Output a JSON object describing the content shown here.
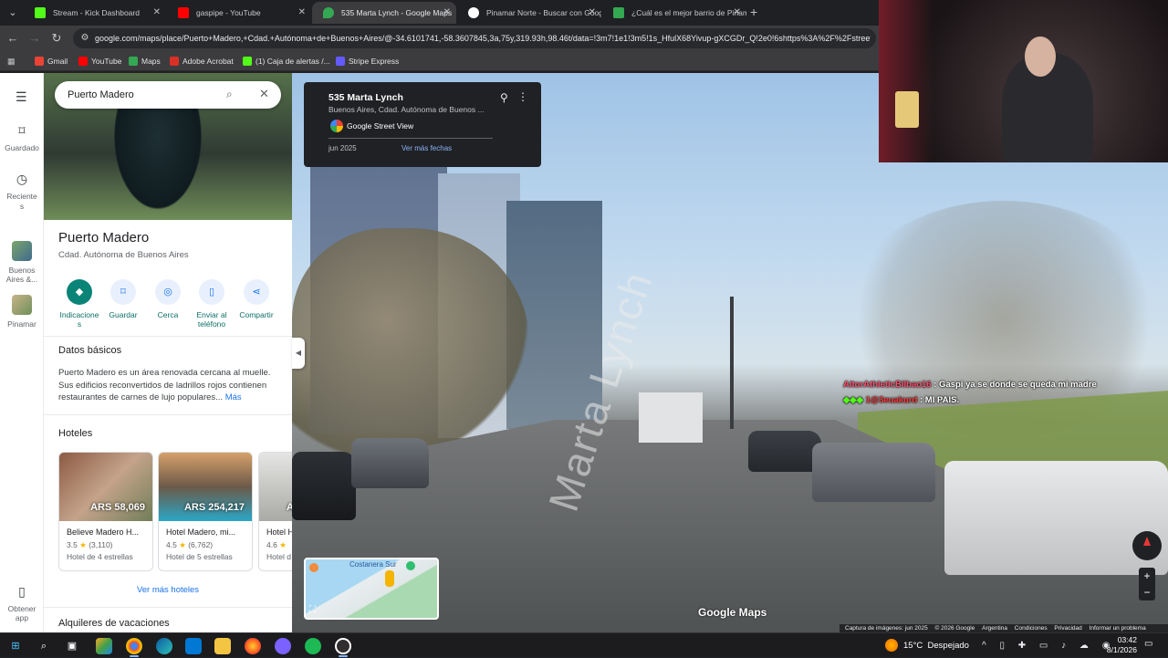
{
  "browser": {
    "tabs": [
      {
        "title": "Stream - Kick Dashboard",
        "favicon_color": "#53fc18",
        "active": false
      },
      {
        "title": "gaspipe - YouTube",
        "favicon_color": "#ff0000",
        "active": false
      },
      {
        "title": "535 Marta Lynch - Google Maps",
        "favicon_color": "#34a853",
        "active": true
      },
      {
        "title": "Pinamar Norte - Buscar con Google",
        "favicon_color": "#4285f4",
        "active": false
      },
      {
        "title": "¿Cuál es el mejor barrio de Pinamar?",
        "favicon_color": "#34a853",
        "active": false
      }
    ],
    "new_tab": "+",
    "url": "google.com/maps/place/Puerto+Madero,+Cdad.+Autónoma+de+Buenos+Aires/@-34.6101741,-58.3607845,3a,75y,319.93h,98.46t/data=!3m7!1e1!3m5!1s_HfulX68Yivup-gXCGDr_Q!2e0!6shttps%3A%2F%2Fstreetv",
    "bookmarks": [
      {
        "label": "Gmail",
        "color": "#ea4335"
      },
      {
        "label": "YouTube",
        "color": "#ff0000"
      },
      {
        "label": "Maps",
        "color": "#34a853"
      },
      {
        "label": "Adobe Acrobat",
        "color": "#d93025"
      },
      {
        "label": "(1) Caja de alertas /...",
        "color": "#53fc18"
      },
      {
        "label": "Stripe Express",
        "color": "#635bff"
      }
    ]
  },
  "maps": {
    "search_value": "Puerto Madero",
    "rail": [
      {
        "label": "Guardado",
        "icon": "bookmark-icon"
      },
      {
        "label": "Reciente s",
        "icon": "history-icon"
      },
      {
        "label": "Buenos Aires &...",
        "icon": "thumbnail"
      },
      {
        "label": "Pinamar",
        "icon": "thumbnail"
      },
      {
        "label": "Obtener app",
        "icon": "phone-icon"
      }
    ],
    "place": {
      "title": "Puerto Madero",
      "subtitle": "Cdad. Autónoma de Buenos Aires"
    },
    "actions": [
      {
        "label": "Indicaciones",
        "icon": "directions-icon"
      },
      {
        "label": "Guardar",
        "icon": "bookmark-icon"
      },
      {
        "label": "Cerca",
        "icon": "nearby-icon"
      },
      {
        "label": "Enviar al teléfono",
        "icon": "phone-icon"
      },
      {
        "label": "Compartir",
        "icon": "share-icon"
      }
    ],
    "basics": {
      "heading": "Datos básicos",
      "text": "Puerto Madero es un área renovada cercana al muelle. Sus edificios reconvertidos de ladrillos rojos contienen restaurantes de carnes de lujo populares...",
      "more": "Más"
    },
    "hotels": {
      "heading": "Hoteles",
      "items": [
        {
          "price": "ARS 58,069",
          "name": "Believe Madero H...",
          "rating": "3.5",
          "reviews": "(3,110)",
          "class": "Hotel de 4 estrellas"
        },
        {
          "price": "ARS 254,217",
          "name": "Hotel Madero, mi...",
          "rating": "4.5",
          "reviews": "(6,762)",
          "class": "Hotel de 5 estrellas"
        },
        {
          "price": "A",
          "name": "Hotel H",
          "rating": "4.6",
          "reviews": "",
          "class": "Hotel d"
        }
      ],
      "more_label": "Ver más hoteles"
    },
    "next_heading": "Alquileres de vacaciones"
  },
  "streetview": {
    "card": {
      "title": "535 Marta Lynch",
      "subtitle": "Buenos Aires, Cdad. Autónoma de Buenos ...",
      "source": "Google Street View",
      "date": "jun 2025",
      "more_dates": "Ver más fechas"
    },
    "road_text": "Marta Lynch",
    "watermark": "Google Maps",
    "minimap_label": "Costanera Sur",
    "footer": [
      "Captura de imágenes: jun 2025",
      "© 2026 Google",
      "Argentina",
      "Condiciones",
      "Privacidad",
      "Informar un problema"
    ],
    "zoom_in": "+",
    "zoom_out": "−"
  },
  "chat": [
    {
      "user": "AitorAthleticBilbao16",
      "user_color": "#ff4d6d",
      "message": ": Gaspi ya se donde se queda mi madre"
    },
    {
      "user": "1@3euakurd",
      "user_color": "#ff3b3b",
      "message": ": MI PAIS."
    }
  ],
  "taskbar": {
    "weather_temp": "15°C",
    "weather_text": "Despejado",
    "time": "03:42",
    "date": "8/1/2026",
    "tray_text": "^ ▯ ✚ ▭ ♪ ☁ ◉"
  },
  "colors": {
    "accent": "#1a73e8",
    "teal": "#0b8478"
  }
}
